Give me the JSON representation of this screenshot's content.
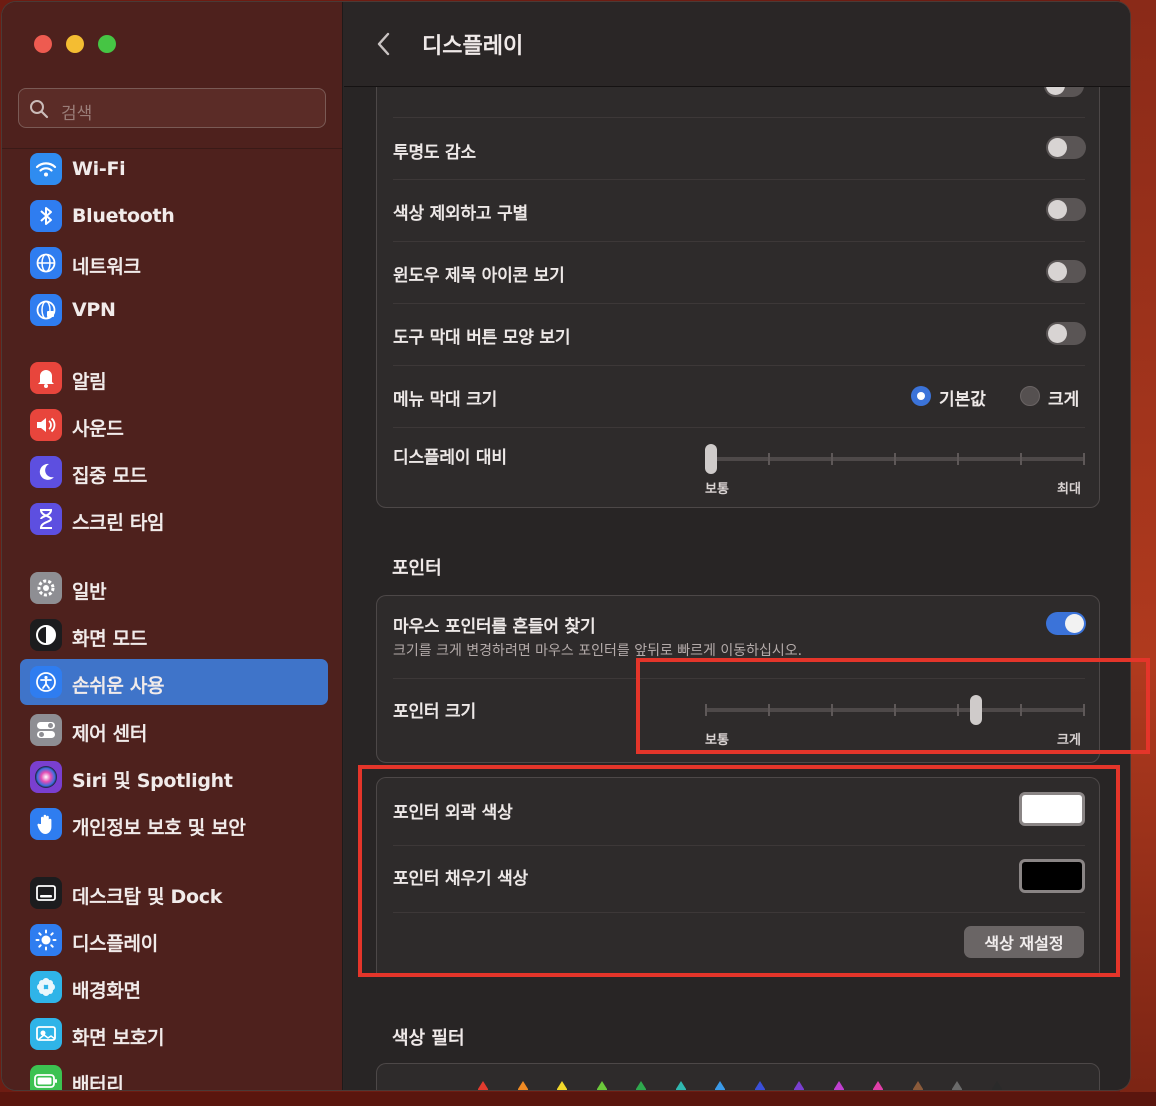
{
  "window": {
    "search_placeholder": "검색",
    "header_title": "디스플레이"
  },
  "sidebar": {
    "items": [
      {
        "label": "Wi-Fi",
        "icon": "wifi-icon",
        "color": "#2f8cf0"
      },
      {
        "label": "Bluetooth",
        "icon": "bluetooth-icon",
        "color": "#2f7df0"
      },
      {
        "label": "네트워크",
        "icon": "globe-icon",
        "color": "#2f7df0"
      },
      {
        "label": "VPN",
        "icon": "vpn-globe-icon",
        "color": "#2f7df0"
      },
      {
        "label": "알림",
        "icon": "bell-icon",
        "color": "#e8453c"
      },
      {
        "label": "사운드",
        "icon": "speaker-icon",
        "color": "#e8453c"
      },
      {
        "label": "집중 모드",
        "icon": "moon-icon",
        "color": "#5d4fe0"
      },
      {
        "label": "스크린 타임",
        "icon": "hourglass-icon",
        "color": "#5d4fe0"
      },
      {
        "label": "일반",
        "icon": "gear-icon",
        "color": "#8e8e93"
      },
      {
        "label": "화면 모드",
        "icon": "appearance-icon",
        "color": "#1c1c1e"
      },
      {
        "label": "손쉬운 사용",
        "icon": "accessibility-icon",
        "color": "#2f7df0",
        "active": true
      },
      {
        "label": "제어 센터",
        "icon": "toggles-icon",
        "color": "#8e8e93"
      },
      {
        "label": "Siri 및 Spotlight",
        "icon": "siri-icon",
        "color": "#7a3fd0"
      },
      {
        "label": "개인정보 보호 및 보안",
        "icon": "hand-icon",
        "color": "#2f7df0"
      },
      {
        "label": "데스크탑 및 Dock",
        "icon": "dock-icon",
        "color": "#1c1c1e"
      },
      {
        "label": "디스플레이",
        "icon": "sun-icon",
        "color": "#2f7df0"
      },
      {
        "label": "배경화면",
        "icon": "flower-icon",
        "color": "#2fb4e8"
      },
      {
        "label": "화면 보호기",
        "icon": "screensaver-icon",
        "color": "#2fb4e8"
      },
      {
        "label": "배터리",
        "icon": "battery-icon",
        "color": "#3cc251"
      }
    ]
  },
  "display_card": {
    "rows": [
      {
        "label": "투명도 감소",
        "toggle": false
      },
      {
        "label": "색상 제외하고 구별",
        "toggle": false
      },
      {
        "label": "윈도우 제목 아이콘 보기",
        "toggle": false
      },
      {
        "label": "도구 막대 버튼 모양 보기",
        "toggle": false
      }
    ],
    "menu_bar": {
      "label": "메뉴 막대 크기",
      "option_default": "기본값",
      "option_large": "크게",
      "selected": "기본값"
    },
    "contrast": {
      "label": "디스플레이 대비",
      "min_label": "보통",
      "max_label": "최대",
      "value_fraction": 0.0
    }
  },
  "pointer": {
    "section_title": "포인터",
    "shake": {
      "label": "마우스 포인터를 흔들어 찾기",
      "description": "크기를 크게 변경하려면 마우스 포인터를 앞뒤로 빠르게 이동하십시오.",
      "toggle": true
    },
    "size": {
      "label": "포인터 크기",
      "min_label": "보통",
      "max_label": "크게",
      "value_fraction": 0.72
    },
    "outline_color": {
      "label": "포인터 외곽 색상",
      "value": "#ffffff"
    },
    "fill_color": {
      "label": "포인터 채우기 색상",
      "value": "#000000"
    },
    "reset_label": "색상 재설정"
  },
  "color_filter": {
    "section_title": "색상 필터",
    "crayon_colors": [
      "#e23b2e",
      "#f08a24",
      "#f2d82a",
      "#6cc83a",
      "#2fa84e",
      "#30b8b0",
      "#3a9ae8",
      "#3a4fd8",
      "#7a3fd0",
      "#c03fd0",
      "#e03fa8",
      "#8a5a3a",
      "#6a6a6a",
      "#2a2a2a"
    ]
  }
}
